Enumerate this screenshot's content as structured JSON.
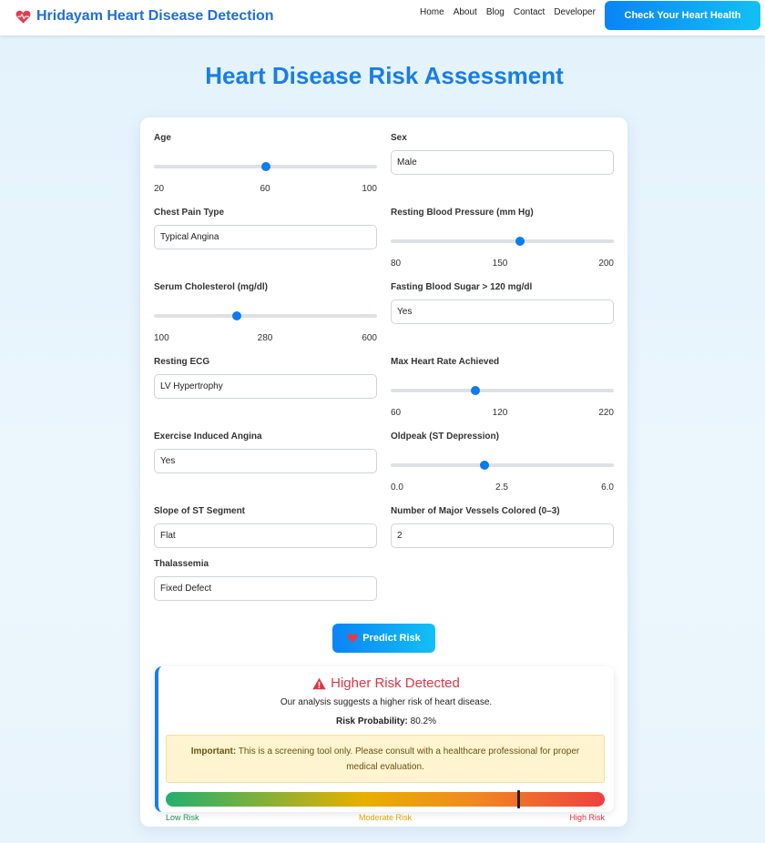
{
  "navbar": {
    "brand": "Hridayam Heart Disease Detection",
    "links": [
      "Home",
      "About",
      "Blog",
      "Contact",
      "Developer"
    ],
    "cta": "Check Your Heart Health"
  },
  "page_title": "Heart Disease Risk Assessment",
  "form": {
    "age": {
      "label": "Age",
      "min": "20",
      "mid": "60",
      "max": "100",
      "value_fraction": 0.5
    },
    "sex": {
      "label": "Sex",
      "value": "Male"
    },
    "chest_pain": {
      "label": "Chest Pain Type",
      "value": "Typical Angina"
    },
    "resting_bp": {
      "label": "Resting Blood Pressure (mm Hg)",
      "min": "80",
      "mid": "150",
      "max": "200",
      "value_fraction": 0.58
    },
    "cholesterol": {
      "label": "Serum Cholesterol (mg/dl)",
      "min": "100",
      "mid": "280",
      "max": "600",
      "value_fraction": 0.37
    },
    "fasting_bs": {
      "label": "Fasting Blood Sugar > 120 mg/dl",
      "value": "Yes"
    },
    "resting_ecg": {
      "label": "Resting ECG",
      "value": "LV Hypertrophy"
    },
    "max_hr": {
      "label": "Max Heart Rate Achieved",
      "min": "60",
      "mid": "120",
      "max": "220",
      "value_fraction": 0.38
    },
    "exercise_angina": {
      "label": "Exercise Induced Angina",
      "value": "Yes"
    },
    "oldpeak": {
      "label": "Oldpeak (ST Depression)",
      "min": "0.0",
      "mid": "2.5",
      "max": "6.0",
      "value_fraction": 0.42
    },
    "st_slope": {
      "label": "Slope of ST Segment",
      "value": "Flat"
    },
    "vessels": {
      "label": "Number of Major Vessels Colored (0–3)",
      "value": "2"
    },
    "thalassemia": {
      "label": "Thalassemia",
      "value": "Fixed Defect"
    }
  },
  "predict_button": "Predict Risk",
  "result": {
    "title": "Higher Risk Detected",
    "subtitle": "Our analysis suggests a higher risk of heart disease.",
    "probability_label": "Risk Probability:",
    "probability_value": "80.2%",
    "probability_fraction": 0.802,
    "notice_bold": "Important:",
    "notice_text": "This is a screening tool only. Please consult with a healthcare professional for proper medical evaluation.",
    "gauge_labels": {
      "low": "Low Risk",
      "moderate": "Moderate Risk",
      "high": "High Risk"
    }
  },
  "colors": {
    "primary": "#1a7de6",
    "danger": "#dc3545",
    "warning_bg": "#fff4d0"
  },
  "icons": {
    "brand": "heartbeat-icon",
    "button": "heart-icon",
    "alert": "warning-triangle-icon"
  }
}
